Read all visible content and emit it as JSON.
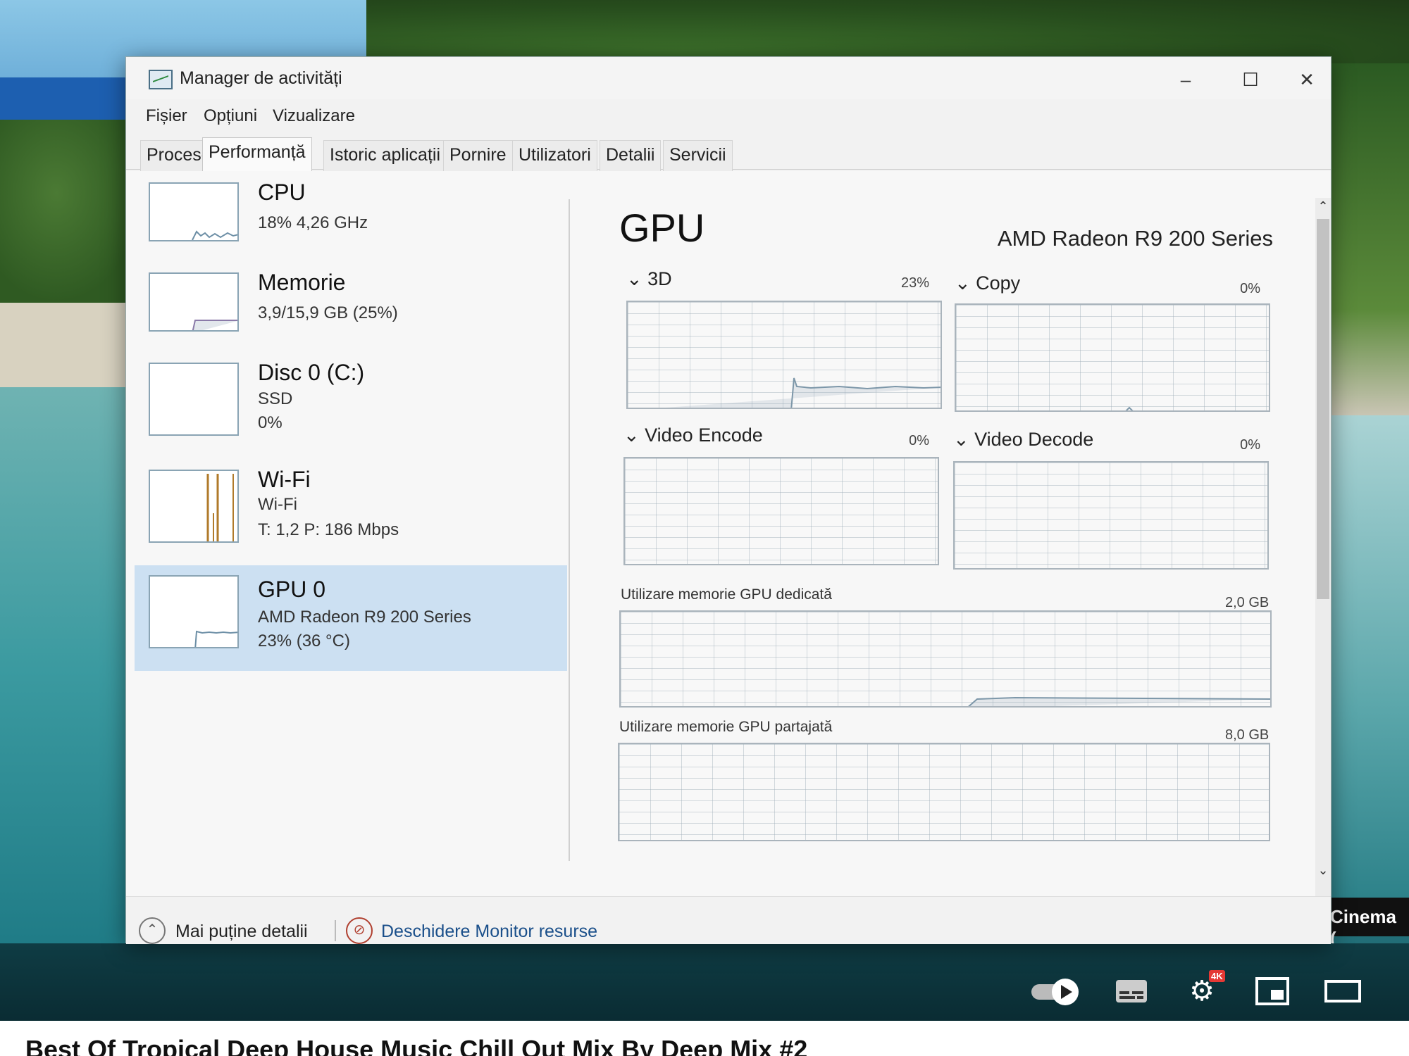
{
  "window": {
    "title": "Manager de activități",
    "controls": [
      "–",
      "☐",
      "✕"
    ]
  },
  "menu": [
    "Fișier",
    "Opțiuni",
    "Vizualizare"
  ],
  "tabs": [
    "Procese",
    "Performanță",
    "Istoric aplicații",
    "Pornire",
    "Utilizatori",
    "Detalii",
    "Servicii"
  ],
  "active_tab": "Performanță",
  "resources": [
    {
      "title": "CPU",
      "lines": [
        "18%  4,26 GHz"
      ]
    },
    {
      "title": "Memorie",
      "lines": [
        "3,9/15,9 GB (25%)"
      ]
    },
    {
      "title": "Disc 0 (C:)",
      "lines": [
        "SSD",
        "0%"
      ]
    },
    {
      "title": "Wi-Fi",
      "lines": [
        "Wi-Fi",
        "T: 1,2  P: 186 Mbps"
      ]
    },
    {
      "title": "GPU 0",
      "lines": [
        "AMD Radeon R9 200 Series",
        "23% (36 °C)"
      ],
      "selected": true
    }
  ],
  "gpu_panel": {
    "title": "GPU",
    "model": "AMD Radeon R9 200 Series",
    "engines": [
      {
        "name": "3D",
        "percent": "23%",
        "value": 0.23
      },
      {
        "name": "Copy",
        "percent": "0%",
        "value": 0
      },
      {
        "name": "Video Encode",
        "percent": "0%",
        "value": 0
      },
      {
        "name": "Video Decode",
        "percent": "0%",
        "value": 0
      }
    ],
    "dedicated_memory": {
      "label": "Utilizare memorie GPU dedicată",
      "max": "2,0 GB"
    },
    "shared_memory": {
      "label": "Utilizare memorie GPU partajată",
      "max": "8,0 GB"
    }
  },
  "footer": {
    "less_details": "Mai puține detalii",
    "open_monitor": "Deschidere Monitor resurse"
  },
  "youtube": {
    "cinema_label": "Cinema (",
    "badge": "4K",
    "video_title": "Best Of Tropical Deep House Music Chill Out Mix By Deep Mix #2"
  },
  "colors": {
    "selected": "#cce0f2",
    "link": "#1a4f8a",
    "graph_line": "#8aa4b4"
  }
}
